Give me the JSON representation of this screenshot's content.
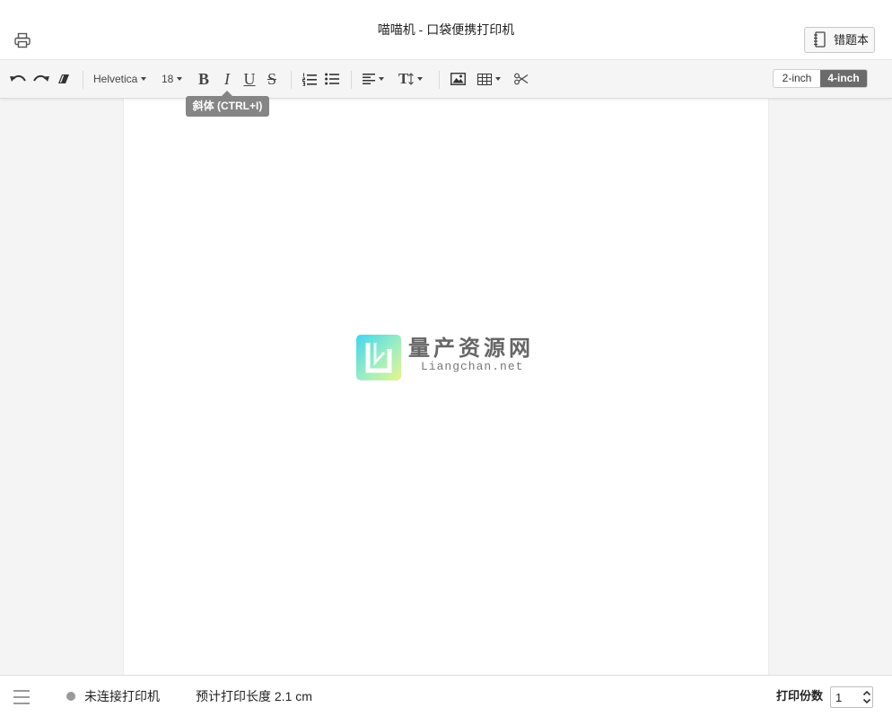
{
  "header": {
    "title": "喵喵机 - 口袋便携打印机",
    "notebook_button": "错题本"
  },
  "toolbar": {
    "font_family": "Helvetica",
    "font_size": "18",
    "bold_label": "B",
    "italic_label": "I",
    "underline_label": "U",
    "strikethrough_label": "S",
    "line_height_label": "T",
    "paper_sizes": [
      {
        "label": "2-inch",
        "selected": false
      },
      {
        "label": "4-inch",
        "selected": true
      }
    ],
    "tooltip": "斜体 (CTRL+I)"
  },
  "watermark": {
    "name": "量产资源网",
    "domain": "Liangchan.net"
  },
  "status_bar": {
    "connection_status": "未连接打印机",
    "estimated_length": "预计打印长度 2.1 cm",
    "copies_label": "打印份数",
    "copies_value": "1"
  },
  "icons": {
    "header": [
      "printer-icon",
      "notebook-icon"
    ],
    "toolbar": [
      "undo-icon",
      "redo-icon",
      "eraser-icon",
      "ordered-list-icon",
      "unordered-list-icon",
      "align-icon",
      "line-height-icon",
      "image-icon",
      "table-icon",
      "scissors-icon",
      "caret-down-icon"
    ],
    "status_bar": [
      "menu-icon",
      "status-dot-icon",
      "chevron-up-icon",
      "chevron-down-icon"
    ]
  },
  "colors": {
    "tooltip_background": "#858585",
    "selected_paper_size": "#6b6b6b",
    "disconnected_dot": "#999999",
    "workspace_background": "#f4f4f4",
    "paper_background": "#ffffff"
  }
}
